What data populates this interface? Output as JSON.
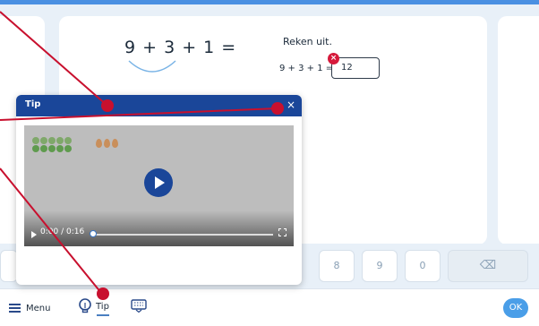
{
  "exercise": {
    "equation": "9 + 3 + 1 =",
    "instruction": "Reken uit.",
    "small_equation": "9 + 3 + 1 =",
    "answer_value": "12",
    "error_symbol": "×"
  },
  "keypad": {
    "keys": [
      "8",
      "9",
      "0"
    ],
    "delete_symbol": "⌫"
  },
  "bottombar": {
    "menu_label": "Menu",
    "tip_label": "Tip",
    "ok_label": "OK"
  },
  "popup": {
    "title": "Tip",
    "close_symbol": "×",
    "video_time": "0:00 / 0:16",
    "progress_fraction": 0.0
  },
  "colors": {
    "accent": "#1a4699",
    "error": "#d6193b",
    "ok": "#4a9ee8",
    "marker": "#c8102e"
  },
  "icons": {
    "menu": "hamburger-icon",
    "tip": "lightbulb-icon",
    "keyboard": "keyboard-icon",
    "close": "close-icon",
    "play": "play-icon"
  }
}
